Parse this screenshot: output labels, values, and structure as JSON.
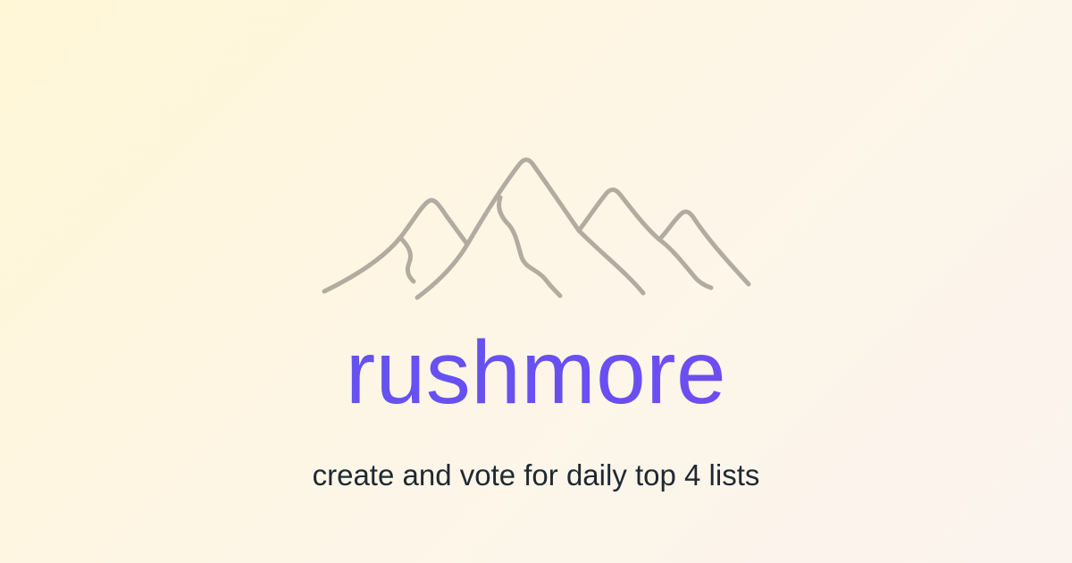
{
  "brand": {
    "name": "rushmore",
    "tagline": "create and vote for daily top 4 lists",
    "logo_icon": "mountains-icon"
  },
  "colors": {
    "background_start": "#fff7d6",
    "background_end": "#fbf3ee",
    "title_gradient_start": "#5c57f0",
    "title_gradient_end": "#7548f2",
    "logo_stroke": "#b3aba0",
    "tagline": "#1f2933"
  }
}
